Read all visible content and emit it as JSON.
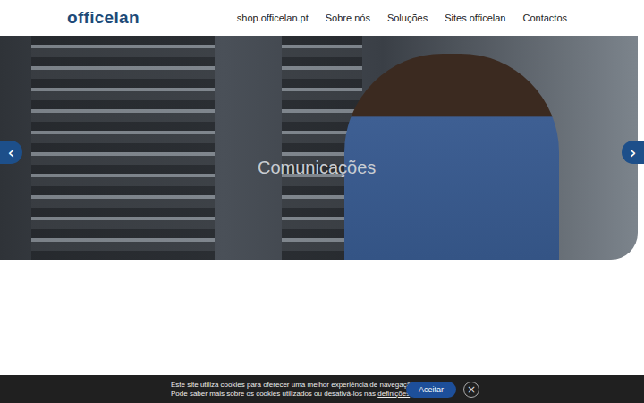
{
  "header": {
    "logo": "officelan",
    "nav": [
      {
        "label": "shop.officelan.pt"
      },
      {
        "label": "Sobre nós"
      },
      {
        "label": "Soluções"
      },
      {
        "label": "Sites officelan"
      },
      {
        "label": "Contactos"
      }
    ]
  },
  "hero": {
    "caption": "Comunicações",
    "prev": "‹",
    "next": "›"
  },
  "cookie_bar": {
    "line1": "Este site utiliza cookies para oferecer uma melhor experiência de navegação.",
    "line2": "Pode saber mais sobre os cookies utilizados ou desativá-los nas ",
    "link": "definições",
    "line2_end": ".",
    "accept": "Aceitar",
    "close": "×"
  }
}
